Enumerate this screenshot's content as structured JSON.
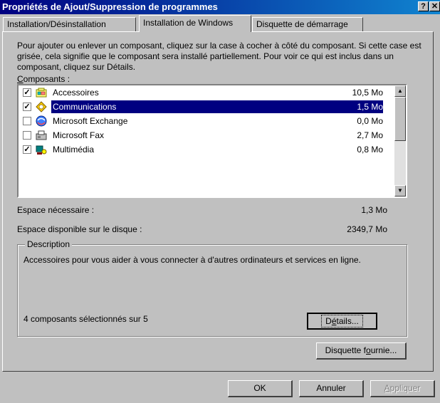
{
  "window": {
    "title": "Propriétés de Ajout/Suppression de programmes",
    "help_label": "?",
    "close_label": "✕"
  },
  "tabs": [
    {
      "label": "Installation/Désinstallation",
      "active": false
    },
    {
      "label": "Installation de Windows",
      "active": true
    },
    {
      "label": "Disquette de démarrage",
      "active": false
    }
  ],
  "intro_text": "Pour ajouter ou enlever un composant, cliquez sur la case à cocher à côté du composant. Si cette case est grisée, cela signifie que le composant sera installé partiellement. Pour voir ce qui est inclus dans un composant, cliquez sur Détails.",
  "components_label_accel": "C",
  "components_label_rest": "omposants :",
  "components": [
    {
      "name": "Accessoires",
      "size": "10,5 Mo",
      "checked": true,
      "icon": "accessories-icon"
    },
    {
      "name": "Communications",
      "size": "1,5 Mo",
      "checked": true,
      "icon": "communications-icon",
      "selected": true
    },
    {
      "name": "Microsoft Exchange",
      "size": "0,0 Mo",
      "checked": false,
      "icon": "exchange-icon"
    },
    {
      "name": "Microsoft Fax",
      "size": "2,7 Mo",
      "checked": false,
      "icon": "fax-icon"
    },
    {
      "name": "Multimédia",
      "size": "0,8 Mo",
      "checked": true,
      "icon": "multimedia-icon"
    }
  ],
  "check_mark": "✓",
  "scroll_up": "▲",
  "scroll_down": "▼",
  "space_required": {
    "label": "Espace nécessaire :",
    "value": "1,3 Mo"
  },
  "space_available": {
    "label": "Espace disponible sur le disque :",
    "value": "2349,7 Mo"
  },
  "description": {
    "legend": "Description",
    "text": "Accessoires pour vous aider à vous connecter à d'autres ordinateurs et services en ligne.",
    "count": "4 composants sélectionnés sur 5"
  },
  "buttons": {
    "details_pre": "D",
    "details_accel": "é",
    "details_post": "tails...",
    "disk_pre": "Disquette f",
    "disk_accel": "o",
    "disk_post": "urnie...",
    "ok": "OK",
    "cancel": "Annuler",
    "apply_accel": "A",
    "apply_post": "ppliquer"
  }
}
